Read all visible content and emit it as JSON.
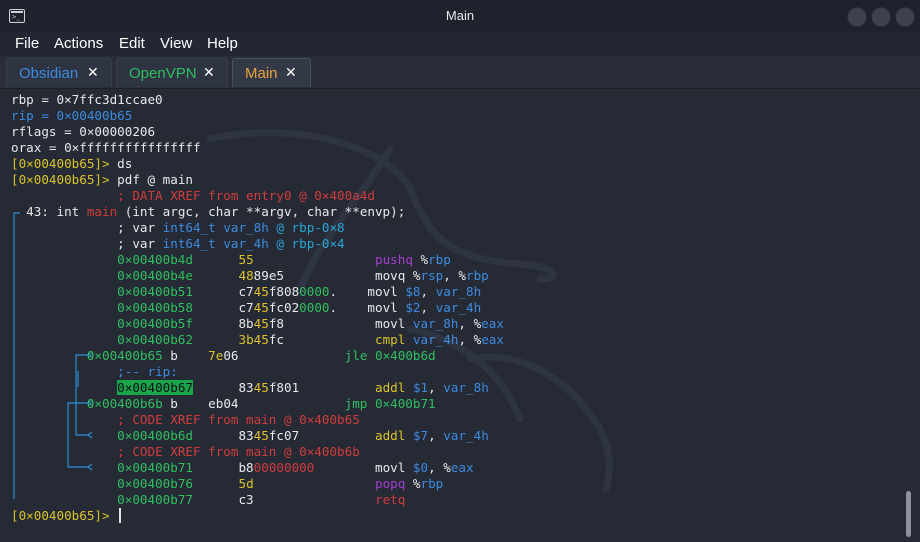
{
  "window": {
    "title": "Main"
  },
  "menu": [
    "File",
    "Actions",
    "Edit",
    "View",
    "Help"
  ],
  "tabs": [
    {
      "label": "Obsidian",
      "color": "#3d8be0",
      "active": false
    },
    {
      "label": "OpenVPN",
      "color": "#2fbf5f",
      "active": false
    },
    {
      "label": "Main",
      "color": "#e8a33a",
      "active": true
    }
  ],
  "tab_close_glyph": "✕",
  "colors": {
    "yellow": "#d9c32a",
    "green": "#2fbf5f",
    "red": "#cf3c3c",
    "blue": "#3d8be0",
    "purple": "#a13fcf",
    "cyan": "#2aa6d6"
  },
  "terminal": {
    "lines": [
      [
        {
          "t": "rbp = 0×7ffc3d1ccae0",
          "c": "w"
        }
      ],
      [
        {
          "t": "rip = 0×00400b65",
          "c": "b"
        }
      ],
      [
        {
          "t": "rflags = 0×00000206",
          "c": "w"
        }
      ],
      [
        {
          "t": "orax = 0×ffffffffffffffff",
          "c": "w"
        }
      ],
      [
        {
          "t": "[0×00400b65]> ",
          "c": "y"
        },
        {
          "t": "ds",
          "c": "w"
        }
      ],
      [
        {
          "t": "[0×00400b65]> ",
          "c": "y"
        },
        {
          "t": "pdf @ main",
          "c": "w"
        }
      ],
      [
        {
          "t": "              ; DATA XREF from entry0 @ 0×400a4d",
          "c": "r"
        }
      ],
      [
        {
          "t": "  43: ",
          "c": "w"
        },
        {
          "t": "int ",
          "c": "w"
        },
        {
          "t": "main",
          "c": "r"
        },
        {
          "t": " (int argc, char **argv, char **envp);",
          "c": "w"
        }
      ],
      [
        {
          "t": "              ; var ",
          "c": "w"
        },
        {
          "t": "int64_t var_8h",
          "c": "b"
        },
        {
          "t": " @ rbp-0×8",
          "c": "cy"
        }
      ],
      [
        {
          "t": "              ; var ",
          "c": "w"
        },
        {
          "t": "int64_t var_4h",
          "c": "b"
        },
        {
          "t": " @ rbp-0×4",
          "c": "cy"
        }
      ],
      [
        {
          "t": "              0×00400b4d",
          "c": "g"
        },
        {
          "t": "      ",
          "c": "w"
        },
        {
          "t": "55",
          "c": "y"
        },
        {
          "t": "                ",
          "c": "w"
        },
        {
          "t": "pushq",
          "c": "p"
        },
        {
          "t": " %",
          "c": "w"
        },
        {
          "t": "rbp",
          "c": "b"
        }
      ],
      [
        {
          "t": "              0×00400b4e",
          "c": "g"
        },
        {
          "t": "      ",
          "c": "w"
        },
        {
          "t": "48",
          "c": "y"
        },
        {
          "t": "89e5",
          "c": "w"
        },
        {
          "t": "            movq %",
          "c": "w"
        },
        {
          "t": "rsp",
          "c": "b"
        },
        {
          "t": ", %",
          "c": "w"
        },
        {
          "t": "rbp",
          "c": "b"
        }
      ],
      [
        {
          "t": "              0×00400b51",
          "c": "g"
        },
        {
          "t": "      c7",
          "c": "w"
        },
        {
          "t": "45",
          "c": "y"
        },
        {
          "t": "f808",
          "c": "w"
        },
        {
          "t": "0000",
          "c": "g"
        },
        {
          "t": ".    movl ",
          "c": "w"
        },
        {
          "t": "$8",
          "c": "b"
        },
        {
          "t": ", ",
          "c": "w"
        },
        {
          "t": "var_8h",
          "c": "b"
        }
      ],
      [
        {
          "t": "              0×00400b58",
          "c": "g"
        },
        {
          "t": "      c7",
          "c": "w"
        },
        {
          "t": "45",
          "c": "y"
        },
        {
          "t": "fc02",
          "c": "w"
        },
        {
          "t": "0000",
          "c": "g"
        },
        {
          "t": ".    movl ",
          "c": "w"
        },
        {
          "t": "$2",
          "c": "b"
        },
        {
          "t": ", ",
          "c": "w"
        },
        {
          "t": "var_4h",
          "c": "b"
        }
      ],
      [
        {
          "t": "              0×00400b5f",
          "c": "g"
        },
        {
          "t": "      8b",
          "c": "w"
        },
        {
          "t": "45",
          "c": "y"
        },
        {
          "t": "f8",
          "c": "w"
        },
        {
          "t": "            movl ",
          "c": "w"
        },
        {
          "t": "var_8h",
          "c": "b"
        },
        {
          "t": ", %",
          "c": "w"
        },
        {
          "t": "eax",
          "c": "b"
        }
      ],
      [
        {
          "t": "              0×00400b62",
          "c": "g"
        },
        {
          "t": "      ",
          "c": "w"
        },
        {
          "t": "3b45",
          "c": "y"
        },
        {
          "t": "fc",
          "c": "w"
        },
        {
          "t": "            ",
          "c": "w"
        },
        {
          "t": "cmpl",
          "c": "y"
        },
        {
          "t": " ",
          "c": "w"
        },
        {
          "t": "var_4h",
          "c": "b"
        },
        {
          "t": ", %",
          "c": "w"
        },
        {
          "t": "eax",
          "c": "b"
        }
      ],
      [
        {
          "t": "          ",
          "c": "w"
        },
        {
          "t": "0×00400b65",
          "c": "g"
        },
        {
          "t": " b    ",
          "c": "w"
        },
        {
          "t": "7e",
          "c": "y"
        },
        {
          "t": "06",
          "c": "w"
        },
        {
          "t": "              ",
          "c": "w"
        },
        {
          "t": "jle 0×400b6d",
          "c": "g"
        }
      ],
      [
        {
          "t": "              ",
          "c": "w"
        },
        {
          "t": ";-- rip:",
          "c": "b"
        }
      ],
      [
        {
          "t": "              ",
          "c": "w"
        },
        {
          "t": "0×00400b67",
          "c": "hl"
        },
        {
          "t": "      83",
          "c": "w"
        },
        {
          "t": "45",
          "c": "y"
        },
        {
          "t": "f801",
          "c": "w"
        },
        {
          "t": "          ",
          "c": "w"
        },
        {
          "t": "addl",
          "c": "y"
        },
        {
          "t": " ",
          "c": "w"
        },
        {
          "t": "$1",
          "c": "b"
        },
        {
          "t": ", ",
          "c": "w"
        },
        {
          "t": "var_8h",
          "c": "b"
        }
      ],
      [
        {
          "t": "          ",
          "c": "w"
        },
        {
          "t": "0×00400b6b",
          "c": "g"
        },
        {
          "t": " b    eb04",
          "c": "w"
        },
        {
          "t": "              ",
          "c": "w"
        },
        {
          "t": "jmp 0×400b71",
          "c": "g"
        }
      ],
      [
        {
          "t": "              ",
          "c": "w"
        },
        {
          "t": "; CODE XREF from main @ 0×400b65",
          "c": "r"
        }
      ],
      [
        {
          "t": "              ",
          "c": "w"
        },
        {
          "t": "0×00400b6d",
          "c": "g"
        },
        {
          "t": "      83",
          "c": "w"
        },
        {
          "t": "45",
          "c": "y"
        },
        {
          "t": "fc07",
          "c": "w"
        },
        {
          "t": "          ",
          "c": "w"
        },
        {
          "t": "addl",
          "c": "y"
        },
        {
          "t": " ",
          "c": "w"
        },
        {
          "t": "$7",
          "c": "b"
        },
        {
          "t": ", ",
          "c": "w"
        },
        {
          "t": "var_4h",
          "c": "b"
        }
      ],
      [
        {
          "t": "              ",
          "c": "w"
        },
        {
          "t": "; CODE XREF from main @ 0×400b6b",
          "c": "r"
        }
      ],
      [
        {
          "t": "              ",
          "c": "w"
        },
        {
          "t": "0×00400b71",
          "c": "g"
        },
        {
          "t": "      b8",
          "c": "w"
        },
        {
          "t": "00000000",
          "c": "r"
        },
        {
          "t": "        movl ",
          "c": "w"
        },
        {
          "t": "$0",
          "c": "b"
        },
        {
          "t": ", %",
          "c": "w"
        },
        {
          "t": "eax",
          "c": "b"
        }
      ],
      [
        {
          "t": "              ",
          "c": "w"
        },
        {
          "t": "0×00400b76",
          "c": "g"
        },
        {
          "t": "      ",
          "c": "w"
        },
        {
          "t": "5d",
          "c": "y"
        },
        {
          "t": "                ",
          "c": "w"
        },
        {
          "t": "popq",
          "c": "p"
        },
        {
          "t": " %",
          "c": "w"
        },
        {
          "t": "rbp",
          "c": "b"
        }
      ],
      [
        {
          "t": "              ",
          "c": "w"
        },
        {
          "t": "0×00400b77",
          "c": "g"
        },
        {
          "t": "      c3",
          "c": "w"
        },
        {
          "t": "                ",
          "c": "w"
        },
        {
          "t": "retq",
          "c": "r"
        }
      ],
      [
        {
          "t": "[0×00400b65]> ",
          "c": "y"
        }
      ]
    ]
  }
}
